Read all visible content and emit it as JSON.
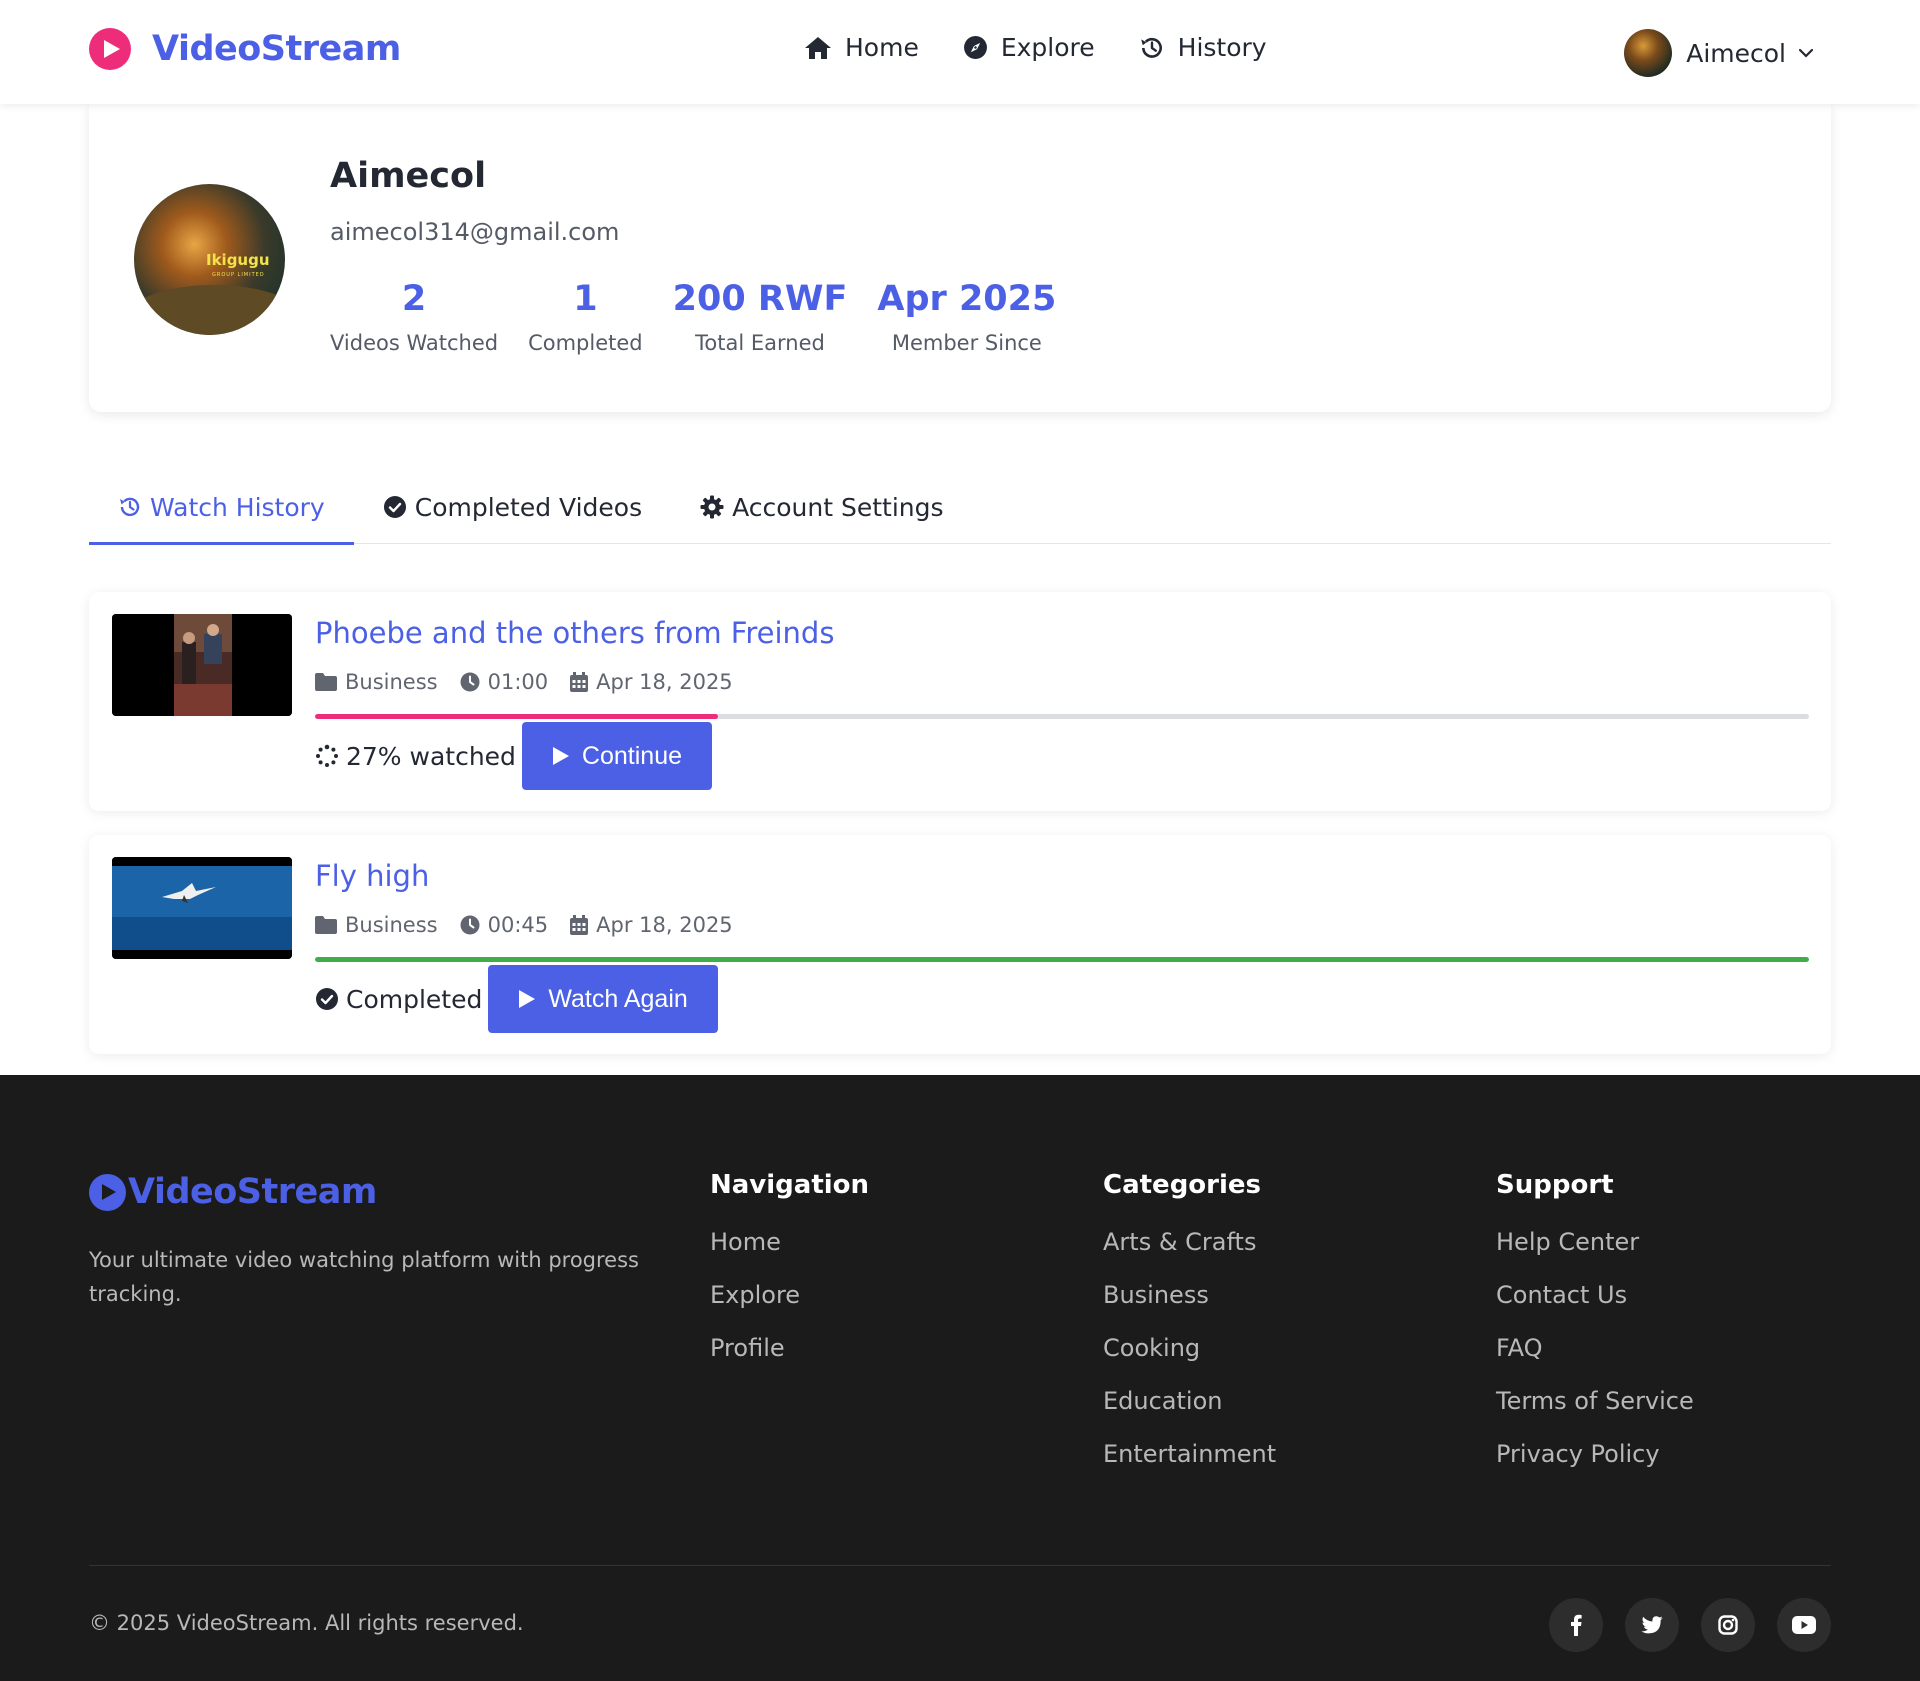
{
  "header": {
    "brand": "VideoStream",
    "nav": [
      {
        "label": "Home",
        "icon": "home-icon"
      },
      {
        "label": "Explore",
        "icon": "compass-icon"
      },
      {
        "label": "History",
        "icon": "history-icon"
      }
    ],
    "user": {
      "name": "Aimecol"
    }
  },
  "profile": {
    "name": "Aimecol",
    "email": "aimecol314@gmail.com",
    "avatar_text": "Ikigugu",
    "avatar_subtext": "GROUP LIMITED",
    "stats": [
      {
        "value": "2",
        "label": "Videos Watched"
      },
      {
        "value": "1",
        "label": "Completed"
      },
      {
        "value": "200 RWF",
        "label": "Total Earned"
      },
      {
        "value": "Apr 2025",
        "label": "Member Since"
      }
    ]
  },
  "tabs": [
    {
      "label": "Watch History",
      "icon": "history-icon",
      "active": true
    },
    {
      "label": "Completed Videos",
      "icon": "check-circle-icon",
      "active": false
    },
    {
      "label": "Account Settings",
      "icon": "gear-icon",
      "active": false
    }
  ],
  "history": [
    {
      "title": "Phoebe and the others from Freinds",
      "category": "Business",
      "duration": "01:00",
      "date": "Apr 18, 2025",
      "progress": 0.27,
      "progress_color": "#ee2d7a",
      "status": "27% watched",
      "button": "Continue"
    },
    {
      "title": "Fly high",
      "category": "Business",
      "duration": "00:45",
      "date": "Apr 18, 2025",
      "progress": 1.0,
      "progress_color": "#3fae49",
      "status": "Completed",
      "button": "Watch Again"
    }
  ],
  "footer": {
    "brand": "VideoStream",
    "description": "Your ultimate video watching platform with progress tracking.",
    "columns": [
      {
        "title": "Navigation",
        "links": [
          "Home",
          "Explore",
          "Profile"
        ]
      },
      {
        "title": "Categories",
        "links": [
          "Arts & Crafts",
          "Business",
          "Cooking",
          "Education",
          "Entertainment"
        ]
      },
      {
        "title": "Support",
        "links": [
          "Help Center",
          "Contact Us",
          "FAQ",
          "Terms of Service",
          "Privacy Policy"
        ]
      }
    ],
    "copyright": "© 2025 VideoStream. All rights reserved.",
    "socials": [
      "facebook-icon",
      "twitter-icon",
      "instagram-icon",
      "youtube-icon"
    ]
  },
  "colors": {
    "accent": "#4c60e6",
    "brand_pink": "#ee2d7a",
    "success": "#3fae49",
    "footer_bg": "#1b1b1b"
  }
}
